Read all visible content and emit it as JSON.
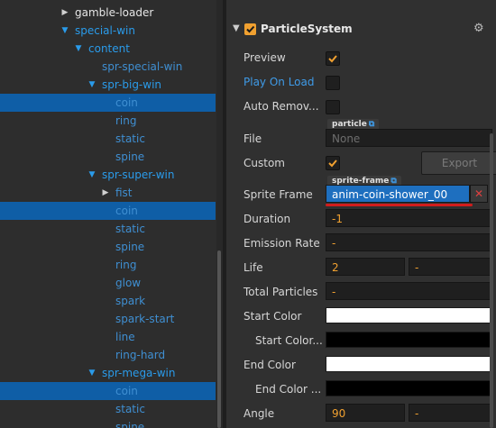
{
  "hierarchy": {
    "rows": [
      {
        "label": "gamble-loader",
        "kind": "top",
        "arrow": "right",
        "selected": false
      },
      {
        "label": "special-win",
        "kind": "blue",
        "arrow": "down",
        "selected": false
      },
      {
        "label": "content",
        "kind": "blue",
        "arrow": "down",
        "selected": false
      },
      {
        "label": "spr-special-win",
        "kind": "leaf",
        "arrow": "",
        "selected": false
      },
      {
        "label": "spr-big-win",
        "kind": "blue",
        "arrow": "down",
        "selected": false
      },
      {
        "label": "coin",
        "kind": "leaf",
        "arrow": "",
        "selected": true
      },
      {
        "label": "ring",
        "kind": "leaf",
        "arrow": "",
        "selected": false
      },
      {
        "label": "static",
        "kind": "leaf",
        "arrow": "",
        "selected": false
      },
      {
        "label": "spine",
        "kind": "leaf",
        "arrow": "",
        "selected": false
      },
      {
        "label": "spr-super-win",
        "kind": "blue",
        "arrow": "down",
        "selected": false
      },
      {
        "label": "fist",
        "kind": "leaf",
        "arrow": "right",
        "selected": false
      },
      {
        "label": "coin",
        "kind": "leaf",
        "arrow": "",
        "selected": true
      },
      {
        "label": "static",
        "kind": "leaf",
        "arrow": "",
        "selected": false
      },
      {
        "label": "spine",
        "kind": "leaf",
        "arrow": "",
        "selected": false
      },
      {
        "label": "ring",
        "kind": "leaf",
        "arrow": "",
        "selected": false
      },
      {
        "label": "glow",
        "kind": "leaf",
        "arrow": "",
        "selected": false
      },
      {
        "label": "spark",
        "kind": "leaf",
        "arrow": "",
        "selected": false
      },
      {
        "label": "spark-start",
        "kind": "leaf",
        "arrow": "",
        "selected": false
      },
      {
        "label": "line",
        "kind": "leaf",
        "arrow": "",
        "selected": false
      },
      {
        "label": "ring-hard",
        "kind": "leaf",
        "arrow": "",
        "selected": false
      },
      {
        "label": "spr-mega-win",
        "kind": "blue",
        "arrow": "down",
        "selected": false
      },
      {
        "label": "coin",
        "kind": "leaf",
        "arrow": "",
        "selected": true
      },
      {
        "label": "static",
        "kind": "leaf",
        "arrow": "",
        "selected": false
      },
      {
        "label": "spine",
        "kind": "leaf",
        "arrow": "",
        "selected": false
      }
    ]
  },
  "inspector": {
    "component_title": "ParticleSystem",
    "component_enabled": true,
    "icons": {
      "collapse": "caret-down-icon",
      "settings": "gear-icon",
      "link": "external-link-icon",
      "clear": "close-icon"
    },
    "colors": {
      "accent": "#f0a030",
      "link_blue": "#3f9be8",
      "selection": "#0f5ea6",
      "highlight_red": "#d21c1c",
      "clear_red": "#e04040"
    },
    "preview_label": "Preview",
    "preview_checked": true,
    "play_on_load_label": "Play On Load",
    "play_on_load_checked": false,
    "auto_remove_label": "Auto Remov...",
    "auto_remove_checked": false,
    "file_label": "File",
    "file_tag": "particle",
    "file_value": "None",
    "custom_label": "Custom",
    "custom_checked": true,
    "export_label": "Export",
    "sprite_frame_label": "Sprite Frame",
    "sprite_frame_tag": "sprite-frame",
    "sprite_frame_value": "anim-coin-shower_00",
    "duration_label": "Duration",
    "duration_value": "-1",
    "emission_rate_label": "Emission Rate",
    "emission_rate_value": "-",
    "life_label": "Life",
    "life_value": "2",
    "life_var_value": "-",
    "total_particles_label": "Total Particles",
    "total_particles_value": "-",
    "start_color_label": "Start Color",
    "start_color": "#ffffff",
    "start_color_var_label": "Start Color...",
    "start_color_var": "#000000",
    "end_color_label": "End Color",
    "end_color": "#ffffff",
    "end_color_var_label": "End Color ...",
    "end_color_var": "#000000",
    "angle_label": "Angle",
    "angle_value": "90",
    "angle_var_value": "-"
  }
}
